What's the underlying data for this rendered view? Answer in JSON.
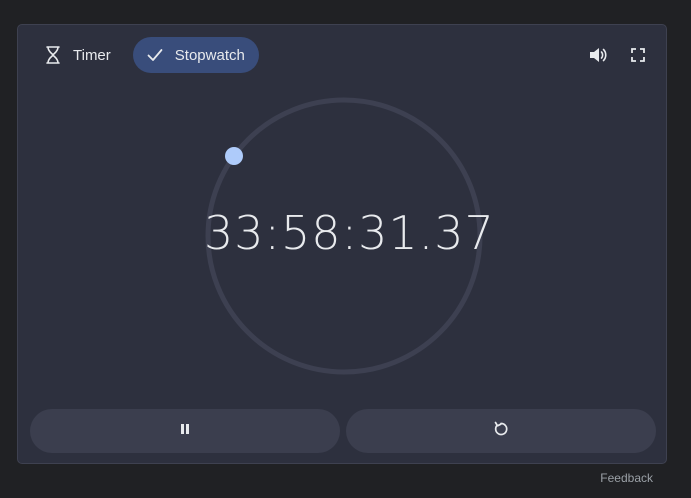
{
  "tabs": [
    {
      "label": "Timer",
      "icon": "hourglass-icon",
      "active": false
    },
    {
      "label": "Stopwatch",
      "icon": "check-icon",
      "active": true
    }
  ],
  "toolbar": {
    "sound_icon": "volume-icon",
    "fullscreen_icon": "fullscreen-icon"
  },
  "stopwatch": {
    "time": "33:58:31.37"
  },
  "controls": {
    "pause_icon": "pause-icon",
    "reset_icon": "reset-icon"
  },
  "footer": {
    "feedback_label": "Feedback"
  },
  "colors": {
    "background": "#202124",
    "card": "#2d303e",
    "active_tab": "#394d7b",
    "ring": "#3d4051",
    "indicator": "#aecbfa",
    "text": "#e8eaed",
    "button": "#3b3e4e"
  }
}
